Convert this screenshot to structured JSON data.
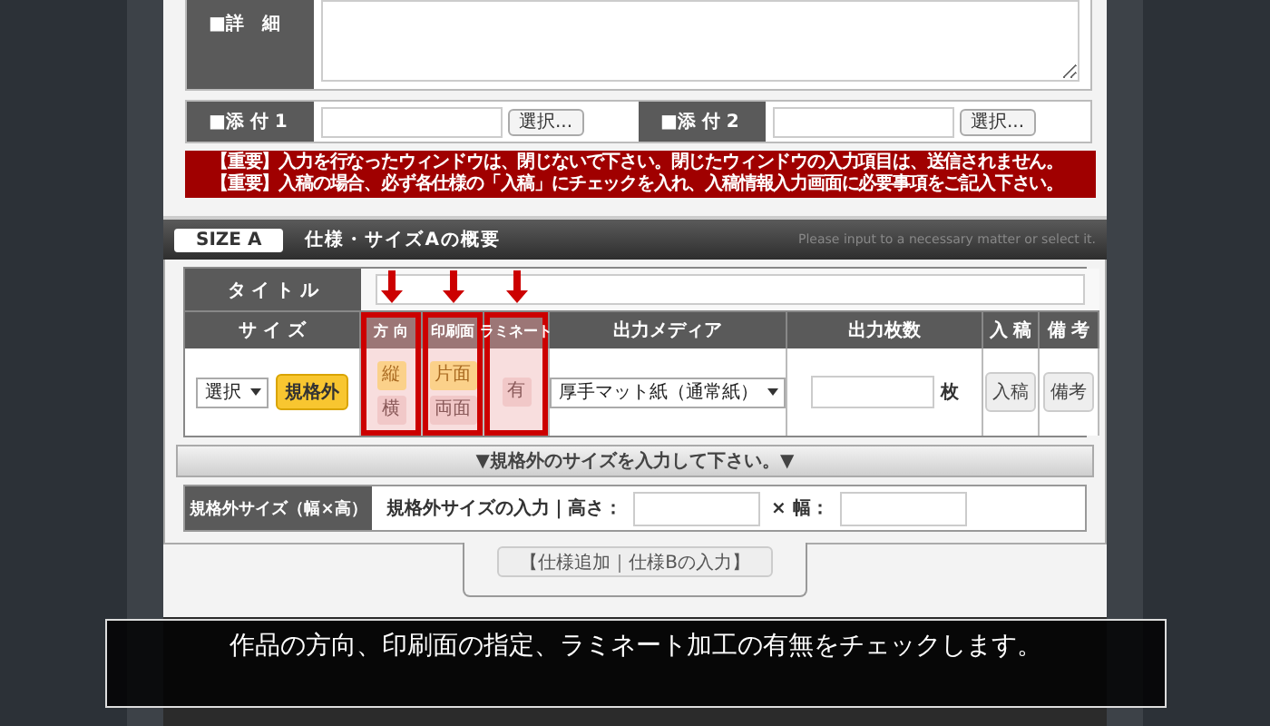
{
  "detail": {
    "label": "■詳　細"
  },
  "attachments": [
    {
      "label": "■添 付 1",
      "button": "選択..."
    },
    {
      "label": "■添 付 2",
      "button": "選択..."
    }
  ],
  "notices": [
    "【重要】入力を行なったウィンドウは、閉じないで下さい。閉じたウィンドウの入力項目は、送信されません。",
    "【重要】入稿の場合、必ず各仕様の「入稿」にチェックを入れ、入稿情報入力画面に必要事項をご記入下さい。"
  ],
  "section": {
    "badge": "SIZE A",
    "title": "仕様・サイズAの概要",
    "hint": "Please input to a necessary matter or select it."
  },
  "title_row": {
    "label": "タ イ ト ル"
  },
  "columns": [
    {
      "label": "サ イ ズ",
      "highlighted": false
    },
    {
      "label": "方 向",
      "highlighted": true
    },
    {
      "label": "印刷面",
      "highlighted": true
    },
    {
      "label": "ラミネート",
      "highlighted": true
    },
    {
      "label": "出力メディア",
      "highlighted": false
    },
    {
      "label": "出力枚数",
      "highlighted": false
    },
    {
      "label": "入 稿",
      "highlighted": false
    },
    {
      "label": "備 考",
      "highlighted": false
    }
  ],
  "size": {
    "select": "選択",
    "button": "規格外"
  },
  "orientation": [
    {
      "label": "縦",
      "selected": true
    },
    {
      "label": "横",
      "selected": false
    }
  ],
  "print_side": [
    {
      "label": "片面",
      "selected": true
    },
    {
      "label": "両面",
      "selected": false
    }
  ],
  "laminate": [
    {
      "label": "有",
      "selected": false
    }
  ],
  "media": {
    "value": "厚手マット紙（通常紙）"
  },
  "quantity": {
    "unit": "枚"
  },
  "buttons": [
    "入稿",
    "備考"
  ],
  "custom_bar": "▼規格外のサイズを入力して下さい。▼",
  "custom_size": {
    "label": "規格外サイズ（幅×高）",
    "prompt": "規格外サイズの入力｜高さ：",
    "width_label": "× 幅："
  },
  "add_button": "【仕様追加｜仕様Bの入力】",
  "caption": "作品の方向、印刷面の指定、ラミネート加工の有無をチェックします。"
}
